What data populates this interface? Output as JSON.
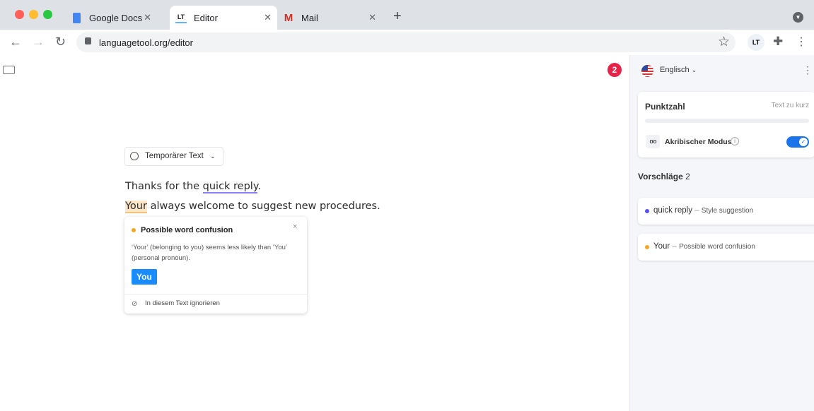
{
  "browser": {
    "tabs": [
      {
        "label": "Google Docs",
        "icon": "google-docs-icon"
      },
      {
        "label": "Editor",
        "icon": "languagetool-icon",
        "active": true
      },
      {
        "label": "Mail",
        "icon": "gmail-icon"
      }
    ],
    "url": "languagetool.org/editor",
    "extension_label": "LT"
  },
  "editor": {
    "error_count": "2",
    "doc_menu": "Temporärer Text",
    "line1_pre": "Thanks for the ",
    "line1_err": "quick reply",
    "line1_post": ".",
    "line2_err": "Your",
    "line2_post": " always welcome to suggest new procedures."
  },
  "popup": {
    "title": "Possible word confusion",
    "message": "‘Your’ (belonging to you) seems less likely than ‘You’ (personal pronoun).",
    "suggestion": "You",
    "ignore": "In diesem Text ignorieren"
  },
  "sidebar": {
    "language": "Englisch",
    "score_label": "Punktzahl",
    "score_status": "Text zu kurz",
    "score_progress": 0,
    "picky_mode": "Akribischer Modus",
    "picky_enabled": true,
    "suggestions_label": "Vorschläge",
    "suggestions_count": "2",
    "suggestions": [
      {
        "word": "quick reply",
        "type": "Style suggestion",
        "color": "#5a4ff0"
      },
      {
        "word": "Your",
        "type": "Possible word confusion",
        "color": "#f5a623"
      }
    ]
  },
  "colors": {
    "accent": "#1a8cff",
    "error_badge": "#e8234a",
    "style": "#5a4ff0",
    "confusion": "#f5a623"
  }
}
